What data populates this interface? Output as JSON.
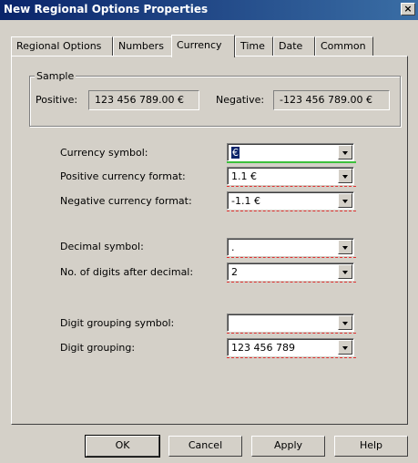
{
  "window": {
    "title": "New Regional Options Properties",
    "close_glyph": "×"
  },
  "tabs": [
    {
      "label": "Regional Options"
    },
    {
      "label": "Numbers"
    },
    {
      "label": "Currency"
    },
    {
      "label": "Time"
    },
    {
      "label": "Date"
    },
    {
      "label": "Common"
    }
  ],
  "sample": {
    "legend": "Sample",
    "positive_label": "Positive:",
    "positive_value": "123 456 789.00 €",
    "negative_label": "Negative:",
    "negative_value": "-123 456 789.00 €"
  },
  "fields": {
    "currency_symbol": {
      "label": "Currency symbol:",
      "value": "€"
    },
    "positive_format": {
      "label": "Positive currency format:",
      "value": "1.1 €"
    },
    "negative_format": {
      "label": "Negative currency format:",
      "value": "-1.1 €"
    },
    "decimal_symbol": {
      "label": "Decimal symbol:",
      "value": "."
    },
    "digits_after_decimal": {
      "label": "No. of digits after decimal:",
      "value": "2"
    },
    "grouping_symbol": {
      "label": "Digit grouping symbol:",
      "value": ""
    },
    "digit_grouping": {
      "label": "Digit grouping:",
      "value": "123 456 789"
    }
  },
  "buttons": {
    "ok": "OK",
    "cancel": "Cancel",
    "apply": "Apply",
    "help": "Help"
  },
  "colors": {
    "titlebar_start": "#0a246a",
    "titlebar_end": "#3a6ea5",
    "validation_red": "#e03030",
    "focus_green": "#3cc03c"
  }
}
